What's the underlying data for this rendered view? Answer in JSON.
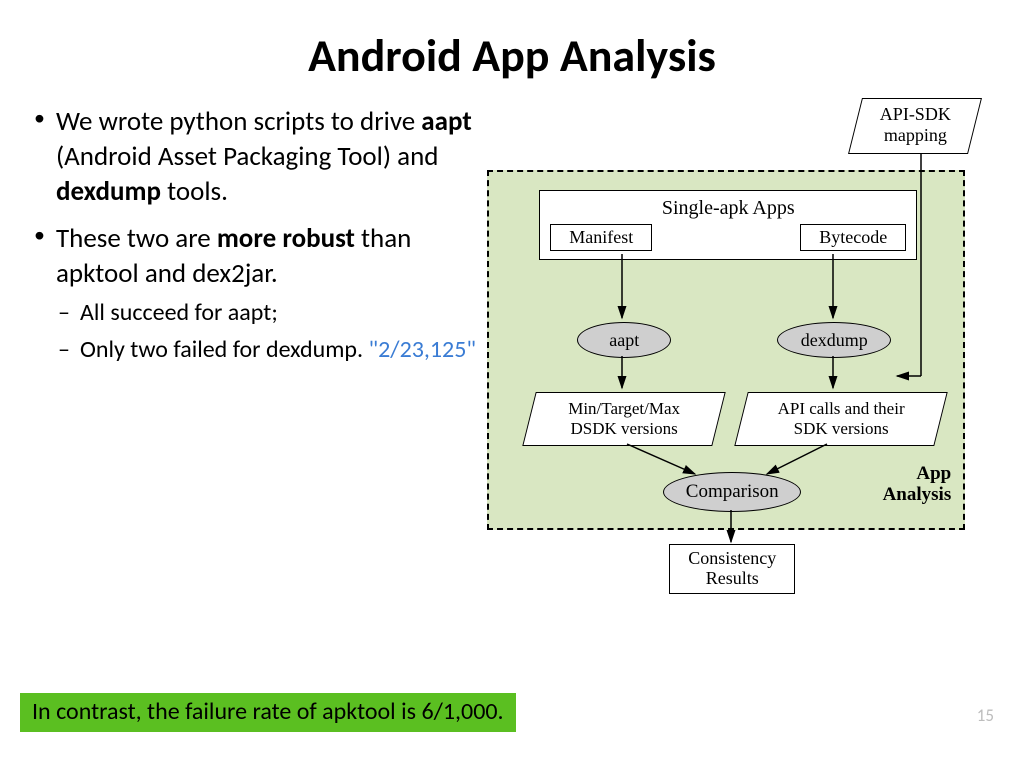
{
  "title": "Android App Analysis",
  "bullets": {
    "b1_part1": "We wrote python scripts to drive ",
    "b1_bold1": "aapt",
    "b1_part2": " (Android Asset Packaging Tool) and ",
    "b1_bold2": "dexdump",
    "b1_part3": " tools.",
    "b2_part1": "These two are ",
    "b2_bold": "more robust",
    "b2_part2": " than apktool and dex2jar.",
    "sub1": "All succeed for aapt;",
    "sub2_part1": "Only two failed for dexdump.  ",
    "sub2_blue": "\"2/23,125\""
  },
  "green_bar": "In contrast, the failure rate of apktool is 6/1,000.",
  "page_num": "15",
  "diagram": {
    "api_sdk_l1": "API-SDK",
    "api_sdk_l2": "mapping",
    "single_apk_title": "Single-apk Apps",
    "manifest": "Manifest",
    "bytecode": "Bytecode",
    "aapt": "aapt",
    "dexdump": "dexdump",
    "paral_left_l1": "Min/Target/Max",
    "paral_left_l2": "DSDK versions",
    "paral_right_l1": "API calls and their",
    "paral_right_l2": "SDK versions",
    "comparison": "Comparison",
    "app_label_l1": "App",
    "app_label_l2": "Analysis",
    "result_l1": "Consistency",
    "result_l2": "Results"
  }
}
